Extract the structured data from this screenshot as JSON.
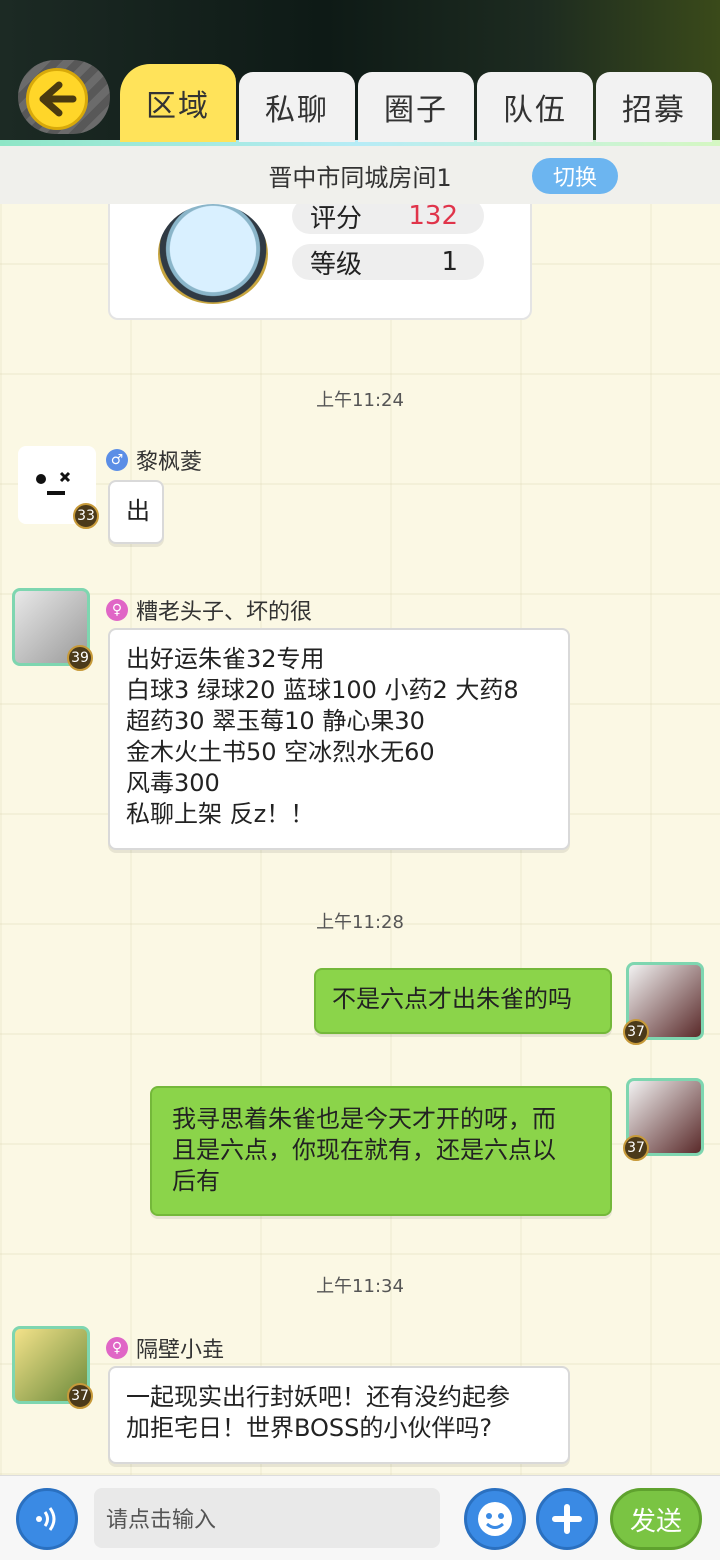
{
  "header": {
    "tabs": [
      {
        "label": "区域",
        "active": true
      },
      {
        "label": "私聊",
        "active": false
      },
      {
        "label": "圈子",
        "active": false
      },
      {
        "label": "队伍",
        "active": false
      },
      {
        "label": "招募",
        "active": false
      }
    ],
    "room_title": "晋中市同城房间1",
    "switch_label": "切换"
  },
  "profile_card": {
    "score_label": "评分",
    "score_value": "132",
    "level_label": "等级",
    "level_value": "1"
  },
  "messages": [
    {
      "time": "上午11:24"
    },
    {
      "sender": "黎枫菱",
      "gender": "male",
      "level": "33",
      "text": "出"
    },
    {
      "sender": "糟老头子、坏的很",
      "gender": "female",
      "level": "39",
      "lines": [
        "出好运朱雀32专用",
        "白球3 绿球20 蓝球100 小药2 大药8",
        "超药30 翠玉莓10 静心果30",
        "金木火土书50 空冰烈水无60",
        "风毒300",
        "私聊上架 反z！！"
      ]
    },
    {
      "time": "上午11:28"
    },
    {
      "sender": "self",
      "level": "37",
      "text": "不是六点才出朱雀的吗"
    },
    {
      "sender": "self",
      "level": "37",
      "lines": [
        "我寻思着朱雀也是今天才开的呀，而",
        "且是六点，你现在就有，还是六点以",
        "后有"
      ]
    },
    {
      "time": "上午11:34"
    },
    {
      "sender": "隔壁小垚",
      "gender": "female",
      "level": "37",
      "lines": [
        "一起现实出行封妖吧！还有没约起参",
        "加拒宅日！世界BOSS的小伙伴吗?"
      ]
    }
  ],
  "input": {
    "placeholder": "请点击输入",
    "send_label": "发送"
  },
  "colors": {
    "active_tab": "#ffe35a",
    "self_bubble": "#8bd44a",
    "button_blue": "#3a8ae4",
    "send_green": "#7ac443"
  }
}
